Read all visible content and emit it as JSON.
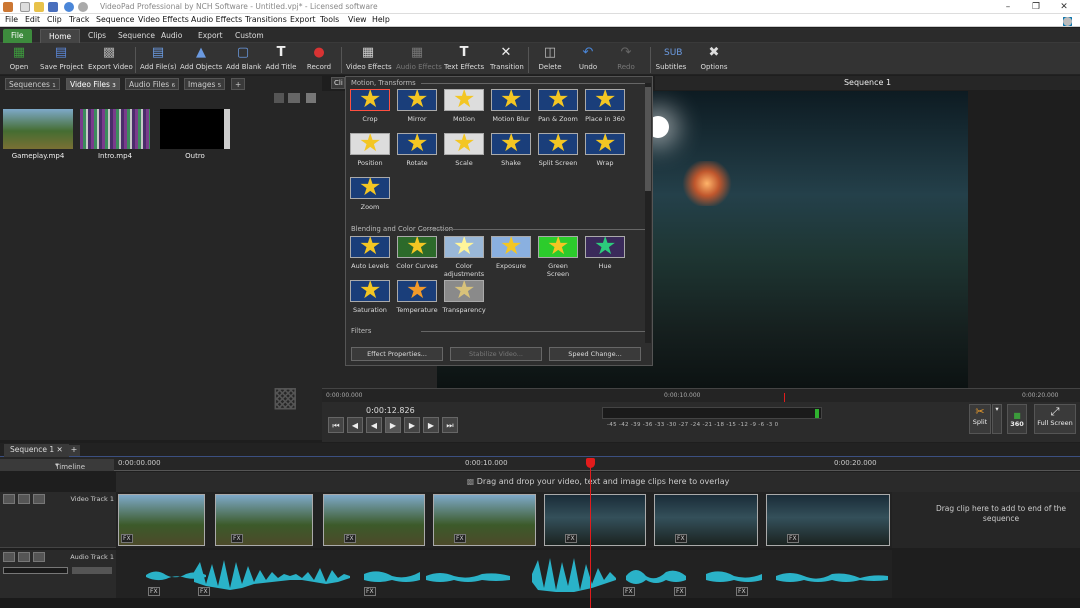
{
  "window": {
    "title": "VideoPad Professional by NCH Software - Untitled.vpj* - Licensed software"
  },
  "menu": [
    "File",
    "Edit",
    "Clip",
    "Track",
    "Sequence",
    "Video Effects",
    "Audio Effects",
    "Transitions",
    "Export",
    "Tools",
    "View",
    "Help"
  ],
  "ribbon_tabs": [
    "File",
    "Home",
    "Clips",
    "Sequence",
    "Audio",
    "Export",
    "Custom"
  ],
  "ribbon": {
    "open": "Open",
    "save_project": "Save Project",
    "export_video": "Export Video",
    "add_files": "Add File(s)",
    "add_objects": "Add Objects",
    "add_blank": "Add Blank",
    "add_title": "Add Title",
    "record": "Record",
    "video_effects": "Video Effects",
    "audio_effects": "Audio Effects",
    "text_effects": "Text Effects",
    "transition": "Transition",
    "delete": "Delete",
    "undo": "Undo",
    "redo": "Redo",
    "subtitles": "Subtitles",
    "options": "Options"
  },
  "file_tabs": {
    "sequences": "Sequences",
    "sequences_count": "1",
    "video_files": "Video Files",
    "video_files_count": "3",
    "audio_files": "Audio Files",
    "audio_files_count": "6",
    "images": "Images",
    "images_count": "5",
    "add": "+"
  },
  "media": [
    {
      "name": "Gameplay.mp4"
    },
    {
      "name": "Intro.mp4"
    },
    {
      "name": "Outro"
    }
  ],
  "effects_dropdown": {
    "clip_tab": "Cli",
    "sections": {
      "motion": "Motion, Transforms",
      "blending": "Blending and Color Correction",
      "filters": "Filters"
    },
    "motion_effects": [
      "Crop",
      "Mirror",
      "Motion",
      "Motion Blur",
      "Pan & Zoom",
      "Place in 360",
      "Position",
      "Rotate",
      "Scale",
      "Shake",
      "Split Screen",
      "Wrap",
      "Zoom"
    ],
    "blending_effects": [
      "Auto Levels",
      "Color Curves",
      "Color adjustments",
      "Exposure",
      "Green Screen",
      "Hue",
      "Saturation",
      "Temperature",
      "Transparency"
    ],
    "buttons": {
      "effect_properties": "Effect Properties...",
      "stabilize": "Stabilize Video...",
      "speed_change": "Speed Change..."
    }
  },
  "preview": {
    "title": "Sequence 1",
    "timecode": "0:00:12.826",
    "slider_marks": [
      "0:00:00.000",
      "0:00:10.000",
      "0:00:20.000"
    ],
    "meter_scale": "-45 -42 -39 -36 -33 -30 -27 -24 -21 -18 -15 -12 -9 -6 -3 0",
    "split": "Split",
    "vr360": "360",
    "full_screen": "Full Screen"
  },
  "timeline": {
    "sequence_tab": "Sequence 1",
    "add_tab": "+",
    "label": "Timeline",
    "ruler": [
      "0:00:00.000",
      "0:00:10.000",
      "0:00:20.000"
    ],
    "overlay_hint": "Drag and drop your video, text and image clips here to overlay",
    "video_track": "Video Track 1",
    "audio_track": "Audio Track 1",
    "drag_end_hint": "Drag clip here to add to end of the sequence",
    "fx_label": "FX"
  },
  "colors": {
    "accent": "#3d8b3d",
    "playhead": "#e21c1c",
    "waveform": "#2ab2c8",
    "star": "#f3c623"
  }
}
